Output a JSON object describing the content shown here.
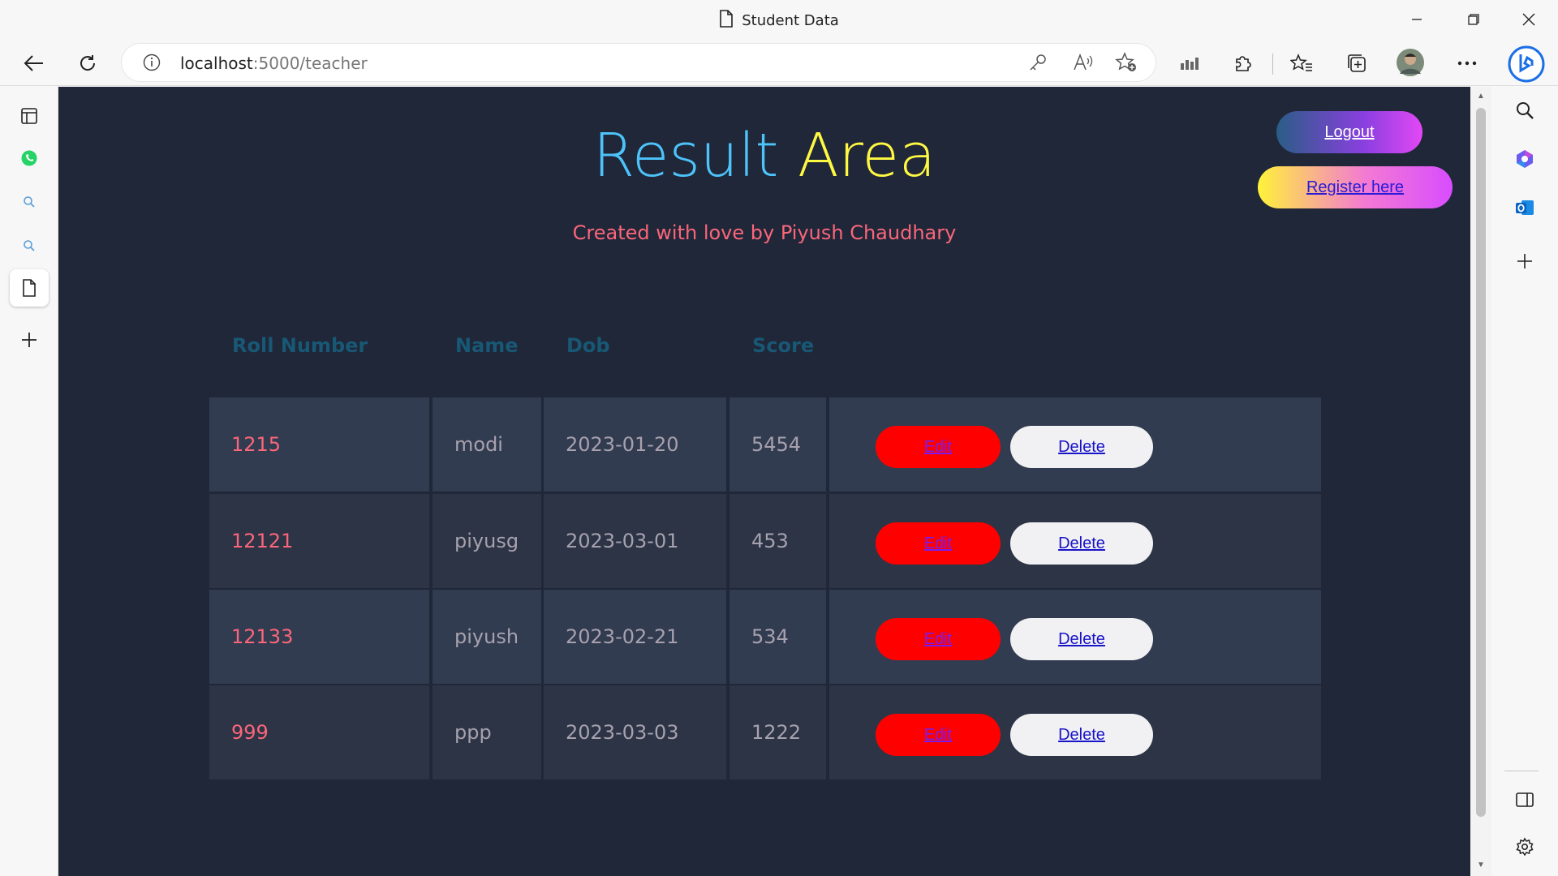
{
  "window": {
    "title": "Student Data"
  },
  "toolbar": {
    "url_host": "localhost",
    "url_path": ":5000/teacher"
  },
  "page": {
    "heading_part1": "Result",
    "heading_part2": "Area",
    "subheading": "Created with love by Piyush Chaudhary",
    "logout_label": "Logout",
    "register_label": "Register here",
    "columns": [
      "Roll Number",
      "Name",
      "Dob",
      "Score"
    ],
    "rows": [
      {
        "roll": "1215",
        "name": "modi",
        "dob": "2023-01-20",
        "score": "5454",
        "edit": "Edit",
        "delete": "Delete"
      },
      {
        "roll": "12121",
        "name": "piyusg",
        "dob": "2023-03-01",
        "score": "453",
        "edit": "Edit",
        "delete": "Delete"
      },
      {
        "roll": "12133",
        "name": "piyush",
        "dob": "2023-02-21",
        "score": "534",
        "edit": "Edit",
        "delete": "Delete"
      },
      {
        "roll": "999",
        "name": "ppp",
        "dob": "2023-03-03",
        "score": "1222",
        "edit": "Edit",
        "delete": "Delete"
      }
    ]
  },
  "colors": {
    "page_bg": "#1f2739",
    "heading_blue": "#4dc3fa",
    "heading_yellow": "#fff842",
    "accent_pink": "#fb667a",
    "header_text": "#185875",
    "edit_button": "#ff0000",
    "delete_button": "#f1f1f3"
  }
}
